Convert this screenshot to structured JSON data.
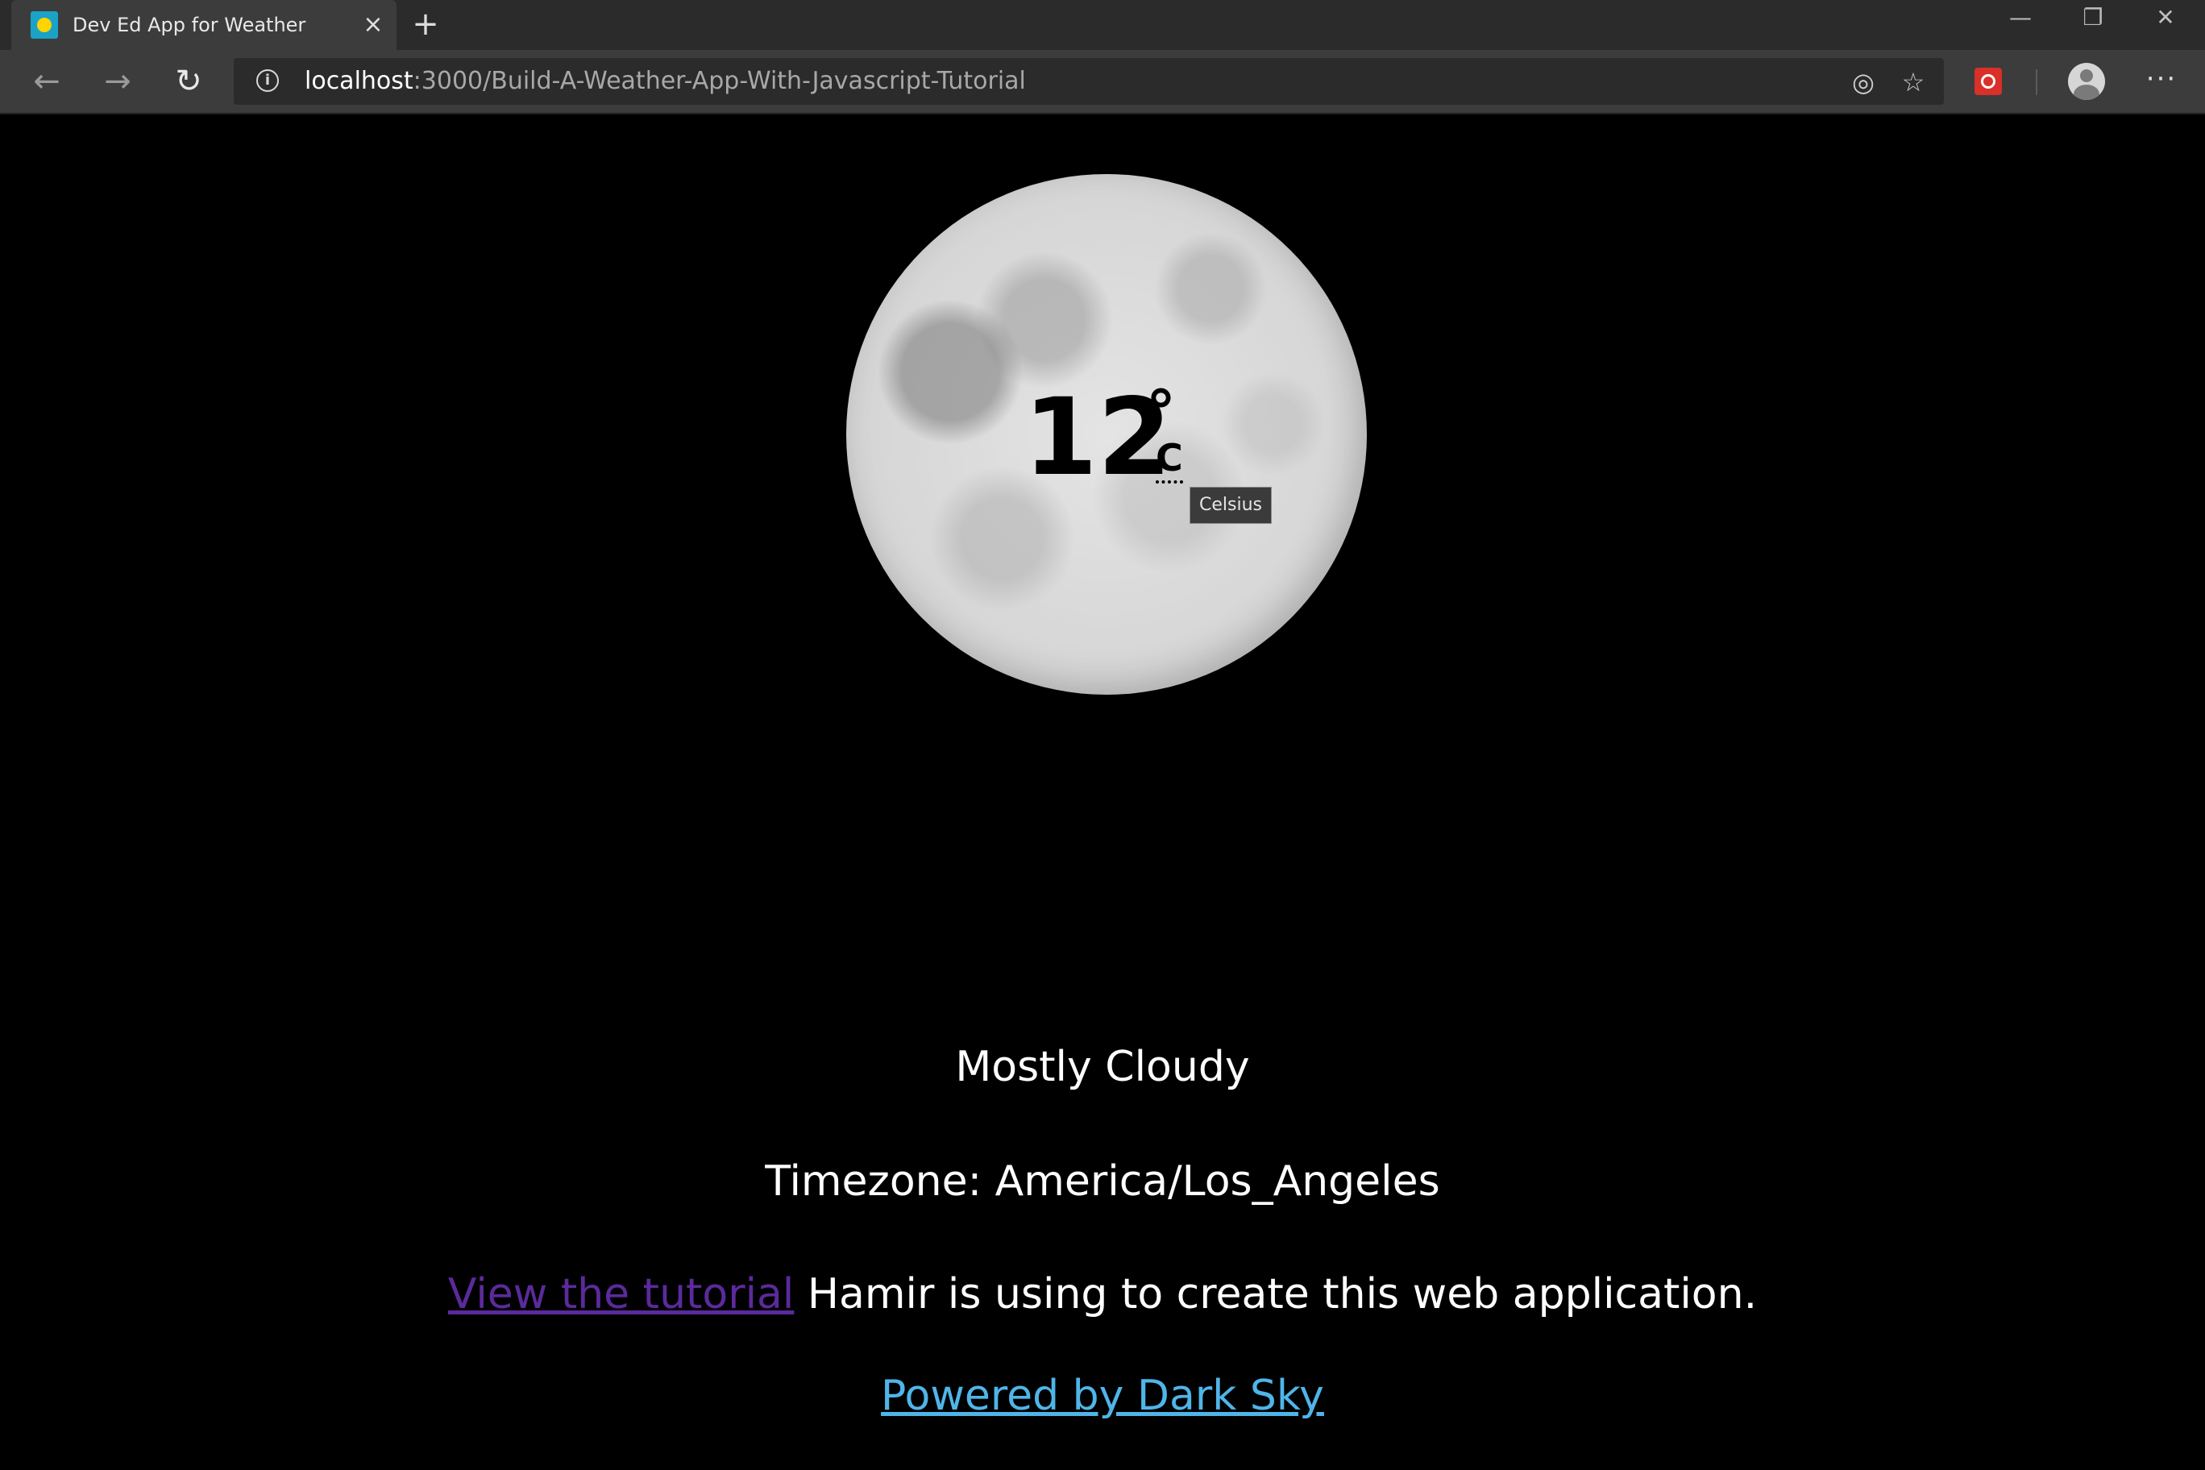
{
  "browser": {
    "tab_title": "Dev Ed App for Weather",
    "tab_close": "×",
    "new_tab": "+",
    "window_minimize": "—",
    "window_restore": "❐",
    "window_close": "✕",
    "url_host": "localhost",
    "url_path": ":3000/Build-A-Weather-App-With-Javascript-Tutorial"
  },
  "icons": {
    "back": "back-arrow-icon",
    "forward": "forward-arrow-icon",
    "reload": "reload-icon",
    "info": "info-icon",
    "location": "location-icon",
    "favorite": "star-icon",
    "extension": "extension-icon",
    "profile": "profile-icon",
    "more": "more-icon"
  },
  "weather": {
    "temperature": "12",
    "degree_symbol": "°",
    "unit": "C",
    "unit_tooltip": "Celsius",
    "summary": "Mostly Cloudy",
    "timezone": "Timezone: America/Los_Angeles"
  },
  "footer": {
    "tutorial_link": "View the tutorial",
    "tutorial_text": " Hamir is using to create this web application.",
    "powered_by": "Powered by Dark Sky"
  },
  "colors": {
    "background": "#000000",
    "visited_link": "#5b2a9c",
    "link": "#4fb5e8"
  }
}
